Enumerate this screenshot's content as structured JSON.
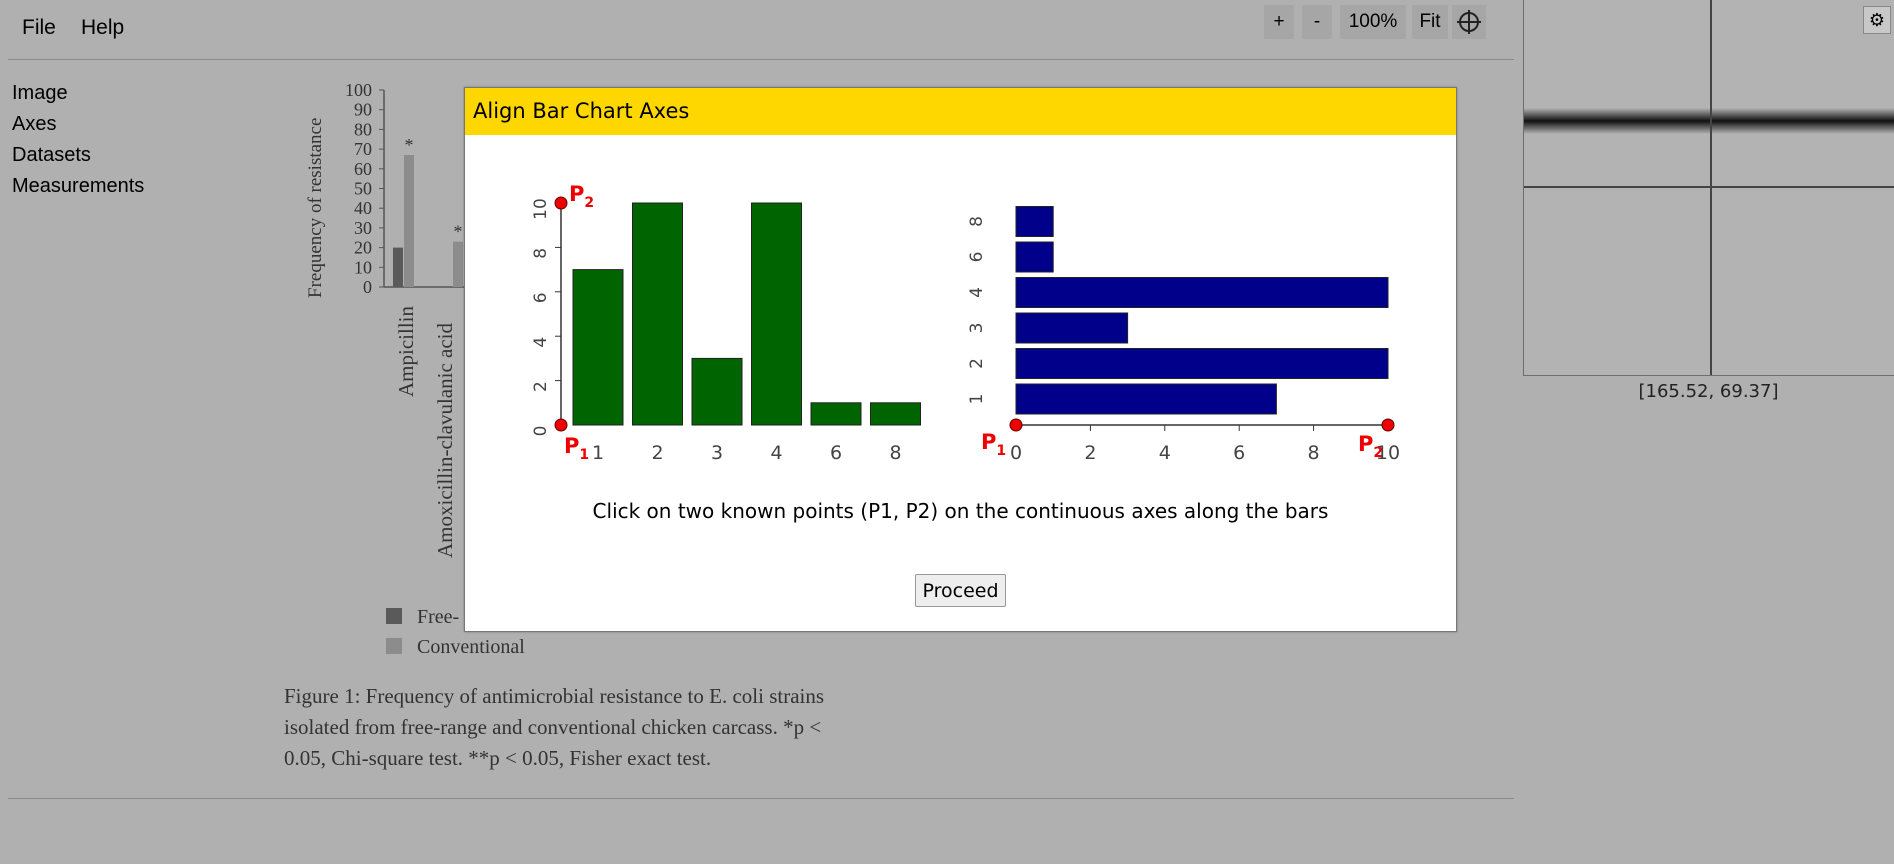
{
  "menu": {
    "file": "File",
    "help": "Help"
  },
  "zoom": {
    "plus": "+",
    "minus": "-",
    "level": "100%",
    "fit": "Fit"
  },
  "sidenav": {
    "items": [
      "Image",
      "Axes",
      "Datasets",
      "Measurements"
    ]
  },
  "figure": {
    "ylabel": "Frequency of resistance",
    "yticks": [
      "100",
      "90",
      "80",
      "70",
      "60",
      "50",
      "40",
      "30",
      "20",
      "10",
      "0"
    ],
    "categories": [
      "Ampicillin",
      "Amoxicillin-clavulanic acid"
    ],
    "star": "*",
    "legend": [
      "Free-",
      "Conventional"
    ],
    "caption_lead": "Figure 1",
    "caption_line1": ": Frequency of antimicrobial resistance to E. coli strains",
    "caption_line2": "isolated from free-range and conventional chicken carcass. *p <",
    "caption_line3": "0.05, Chi-square test. **p < 0.05, Fisher exact test."
  },
  "chart_data": {
    "type": "bar",
    "categories": [
      "Ampicillin",
      "Amoxicillin-clavulanic acid"
    ],
    "ylabel": "Frequency of resistance",
    "ylim": [
      0,
      100
    ],
    "series": [
      {
        "name": "Free-",
        "values": [
          20,
          null
        ]
      },
      {
        "name": "Conventional",
        "values": [
          67,
          23
        ]
      }
    ]
  },
  "magnifier": {
    "coords": "[165.52, 69.37]",
    "settings_icon": "gear-icon"
  },
  "dialog": {
    "title": "Align Bar Chart Axes",
    "instruction": "Click on two known points (P1, P2) on the continuous axes along the bars",
    "proceed": "Proceed",
    "vertical_example": {
      "categories": [
        "1",
        "2",
        "4",
        "6",
        "8"
      ],
      "categories_all": [
        "1",
        "2",
        "3",
        "4",
        "6",
        "8"
      ],
      "values": [
        7,
        10,
        3,
        10,
        1,
        1
      ],
      "yticks": [
        "0",
        "2",
        "4",
        "6",
        "8",
        "10"
      ],
      "color": "#006400"
    },
    "horizontal_example": {
      "categories": [
        "1",
        "2",
        "3",
        "4",
        "6",
        "8"
      ],
      "values": [
        7,
        10,
        3,
        10,
        1,
        1
      ],
      "xticks": [
        "0",
        "2",
        "4",
        "6",
        "8",
        "10"
      ],
      "color": "#00008b"
    },
    "p1": "P",
    "p2": "P",
    "sub1": "1",
    "sub2": "2"
  }
}
